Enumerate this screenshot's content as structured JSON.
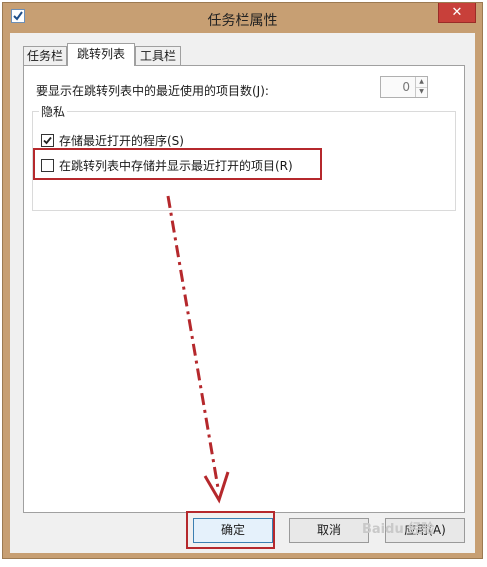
{
  "window": {
    "title": "任务栏属性",
    "close_symbol": "✕"
  },
  "tabs": [
    {
      "label": "任务栏",
      "active": false
    },
    {
      "label": "跳转列表",
      "active": true
    },
    {
      "label": "工具栏",
      "active": false
    }
  ],
  "jumplist": {
    "recent_count_label": "要显示在跳转列表中的最近使用的项目数(J):",
    "recent_count_value": "0",
    "privacy": {
      "title": "隐私",
      "options": [
        {
          "label": "存储最近打开的程序(S)",
          "checked": true
        },
        {
          "label": "在跳转列表中存储并显示最近打开的项目(R)",
          "checked": false
        }
      ]
    }
  },
  "buttons": {
    "ok": "确定",
    "cancel": "取消",
    "apply": "应用(A)"
  },
  "colors": {
    "frame": "#c79f73",
    "annotation_red": "#b5282c"
  },
  "icons": {
    "app": "taskbar-properties-icon",
    "check": "checkmark-icon",
    "spin_up": "chevron-up-icon",
    "spin_down": "chevron-down-icon"
  }
}
